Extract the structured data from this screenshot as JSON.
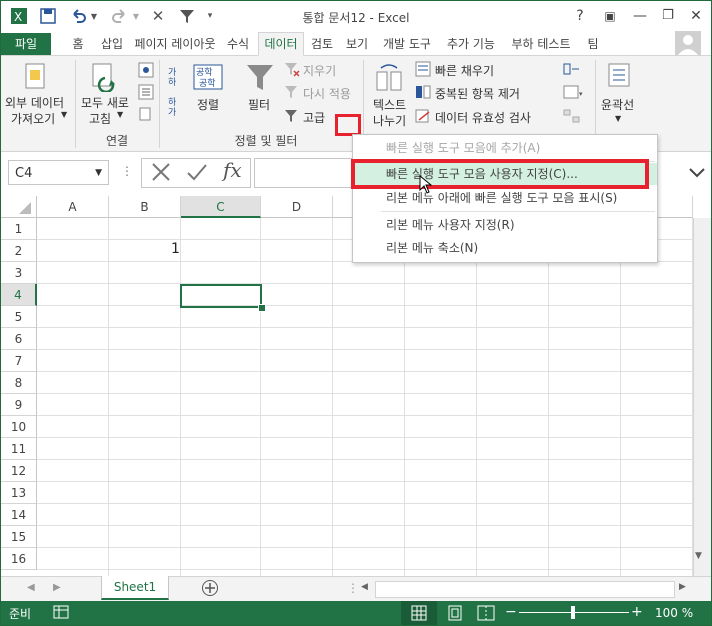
{
  "title": "통합 문서12 - Excel",
  "window": {
    "help": "?",
    "minimize": "—",
    "close": "✕"
  },
  "tabs": [
    "파일",
    "홈",
    "삽입",
    "페이지 레이아웃",
    "수식",
    "데이터",
    "검토",
    "보기",
    "개발 도구",
    "추가 기능",
    "부하 테스트",
    "팀"
  ],
  "ribbon": {
    "external_data": [
      "외부 데이터",
      "가져오기"
    ],
    "refresh_all": [
      "모두 새로",
      "고침"
    ],
    "sort": "정렬",
    "filter": "필터",
    "clear": "지우기",
    "reapply": "다시 적용",
    "advanced": "고급",
    "text_to_columns": [
      "텍스트",
      "나누기"
    ],
    "flash_fill": "빠른 채우기",
    "remove_duplicates": "중복된 항목 제거",
    "data_validation": "데이터 유효성 검사",
    "outline": "윤곽선",
    "groups": {
      "connections": "연결",
      "sort_filter": "정렬 및 필터"
    }
  },
  "formula_bar": {
    "name_box": "C4",
    "fx": "fx"
  },
  "columns": [
    "A",
    "B",
    "C",
    "D"
  ],
  "rows": [
    "1",
    "2",
    "3",
    "4",
    "5",
    "6",
    "7",
    "8",
    "9",
    "10",
    "11",
    "12",
    "13",
    "14",
    "15",
    "16"
  ],
  "cells": {
    "B2": "1"
  },
  "context_menu": [
    "빠른 실행 도구 모음에 추가(A)",
    "빠른 실행 도구 모음 사용자 지정(C)...",
    "리본 메뉴 아래에 빠른 실행 도구 모음 표시(S)",
    "리본 메뉴 사용자 지정(R)",
    "리본 메뉴 축소(N)"
  ],
  "sheet_tab": "Sheet1",
  "status": {
    "ready": "준비",
    "zoom": "100 %"
  },
  "colors": {
    "excel_green": "#217346",
    "highlight_red": "#e8212e",
    "menu_highlight": "#d3f0e0"
  }
}
